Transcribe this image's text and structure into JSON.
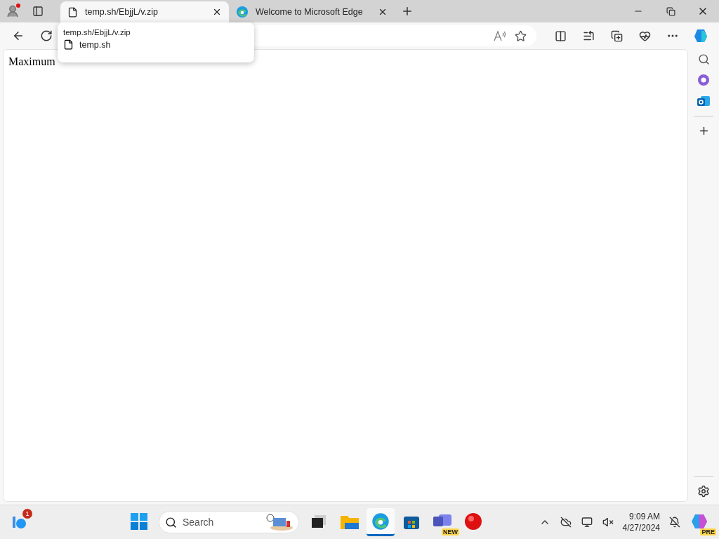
{
  "tabs": [
    {
      "title": "temp.sh/EbjjL/v.zip",
      "kind": "file",
      "selected": true
    },
    {
      "title": "Welcome to Microsoft Edge",
      "kind": "edge",
      "selected": false
    }
  ],
  "tab_hover_card": {
    "url": "temp.sh/EbjjL/v.zip",
    "title": "temp.sh"
  },
  "page": {
    "text": "Maximum"
  },
  "taskbar": {
    "widgets_badge": "1",
    "search": {
      "placeholder": "Search"
    },
    "apps": [
      {
        "kind": "terminal",
        "selected": false
      },
      {
        "kind": "folder",
        "selected": false
      },
      {
        "kind": "edge",
        "selected": true
      },
      {
        "kind": "store",
        "selected": false
      },
      {
        "kind": "teams",
        "badge": "NEW",
        "selected": false
      },
      {
        "kind": "record",
        "selected": false
      }
    ],
    "clock": {
      "time": "9:09 AM",
      "date": "4/27/2024"
    },
    "copilot_badge": "PRE"
  }
}
